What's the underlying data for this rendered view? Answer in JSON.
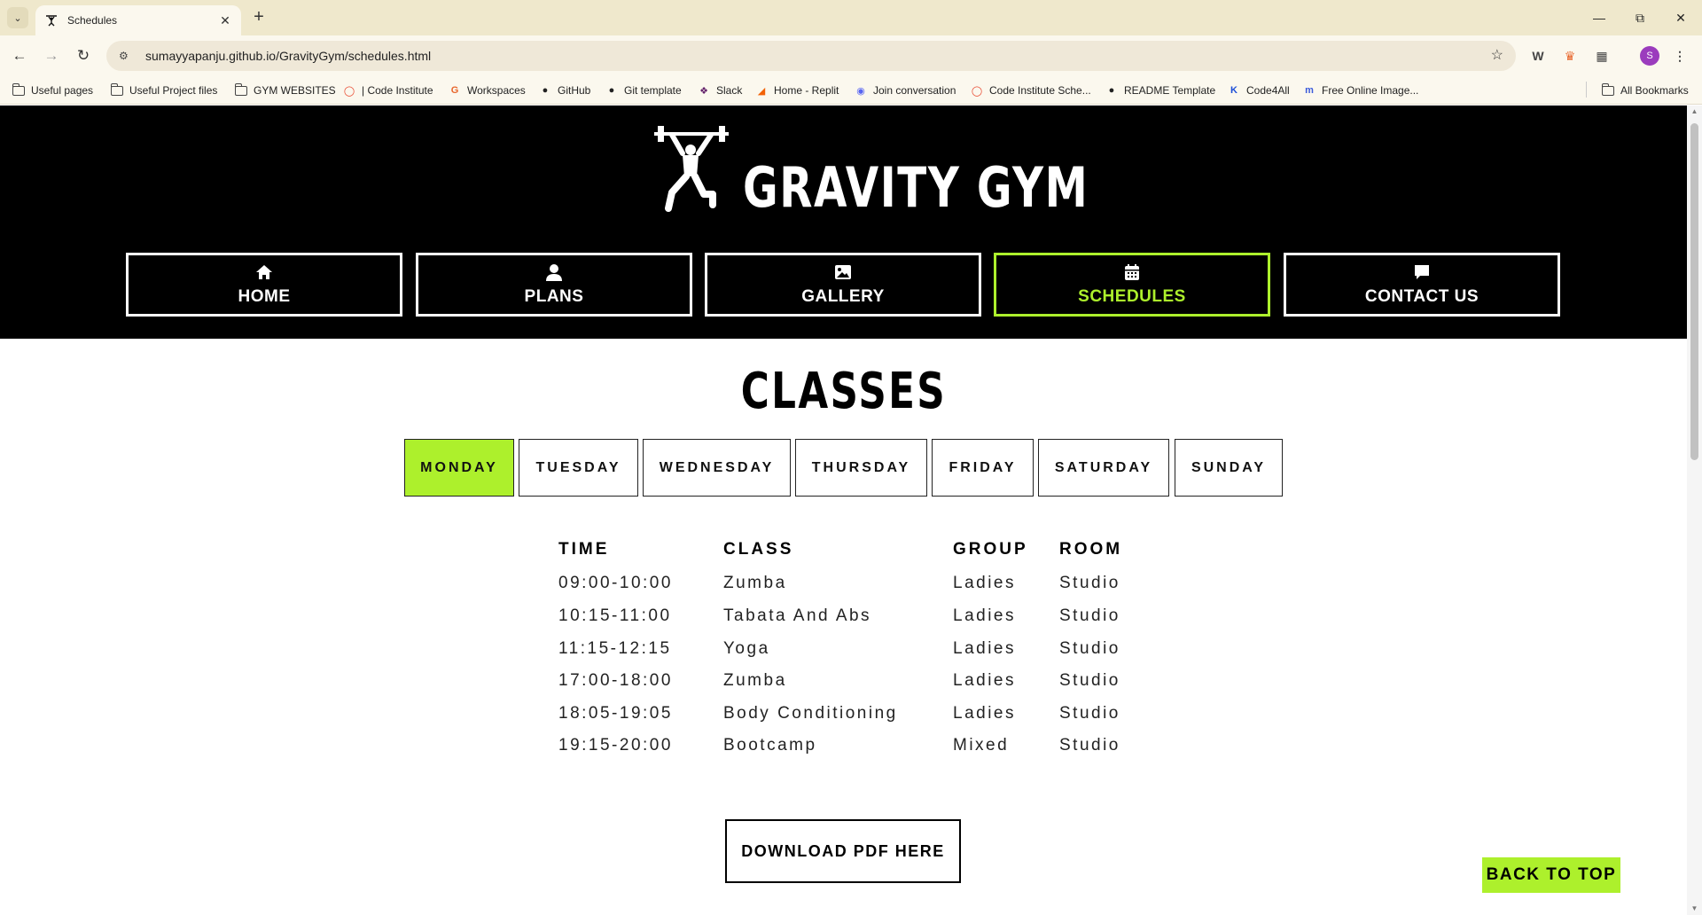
{
  "browser": {
    "tab_title": "Schedules",
    "url": "sumayyapanju.github.io/GravityGym/schedules.html",
    "profile_initial": "S",
    "bookmarks": [
      {
        "label": "Useful pages",
        "icon": "folder-icon"
      },
      {
        "label": "Useful Project files",
        "icon": "folder-icon"
      },
      {
        "label": "GYM WEBSITES",
        "icon": "folder-icon"
      },
      {
        "label": "| Code Institute",
        "icon": "code-institute-icon"
      },
      {
        "label": "Workspaces",
        "icon": "workspaces-icon"
      },
      {
        "label": "GitHub",
        "icon": "github-icon"
      },
      {
        "label": "Git template",
        "icon": "github-icon"
      },
      {
        "label": "Slack",
        "icon": "slack-icon"
      },
      {
        "label": "Home - Replit",
        "icon": "replit-icon"
      },
      {
        "label": "Join conversation",
        "icon": "discord-icon"
      },
      {
        "label": "Code Institute Sche...",
        "icon": "code-institute-icon"
      },
      {
        "label": "README Template",
        "icon": "github-icon"
      },
      {
        "label": "Code4All",
        "icon": "code4all-icon"
      },
      {
        "label": "Free Online Image...",
        "icon": "image-tool-icon"
      }
    ],
    "all_bookmarks": "All Bookmarks"
  },
  "site": {
    "logo_text": "GRAVITY GYM",
    "nav": [
      {
        "label": "HOME",
        "icon": "home-icon"
      },
      {
        "label": "PLANS",
        "icon": "user-icon"
      },
      {
        "label": "GALLERY",
        "icon": "image-icon"
      },
      {
        "label": "SCHEDULES",
        "icon": "calendar-icon",
        "active": true
      },
      {
        "label": "CONTACT US",
        "icon": "comment-icon"
      }
    ],
    "accent_color": "#adf02c"
  },
  "classes": {
    "title": "CLASSES",
    "days": [
      "MONDAY",
      "TUESDAY",
      "WEDNESDAY",
      "THURSDAY",
      "FRIDAY",
      "SATURDAY",
      "SUNDAY"
    ],
    "selected_day": "MONDAY",
    "headers": [
      "TIME",
      "CLASS",
      "GROUP",
      "ROOM"
    ],
    "rows": [
      [
        "09:00-10:00",
        "Zumba",
        "Ladies",
        "Studio"
      ],
      [
        "10:15-11:00",
        "Tabata And Abs",
        "Ladies",
        "Studio"
      ],
      [
        "11:15-12:15",
        "Yoga",
        "Ladies",
        "Studio"
      ],
      [
        "17:00-18:00",
        "Zumba",
        "Ladies",
        "Studio"
      ],
      [
        "18:05-19:05",
        "Body Conditioning",
        "Ladies",
        "Studio"
      ],
      [
        "19:15-20:00",
        "Bootcamp",
        "Mixed",
        "Studio"
      ]
    ],
    "download_label": "DOWNLOAD PDF HERE"
  },
  "back_to_top": "BACK TO TOP"
}
